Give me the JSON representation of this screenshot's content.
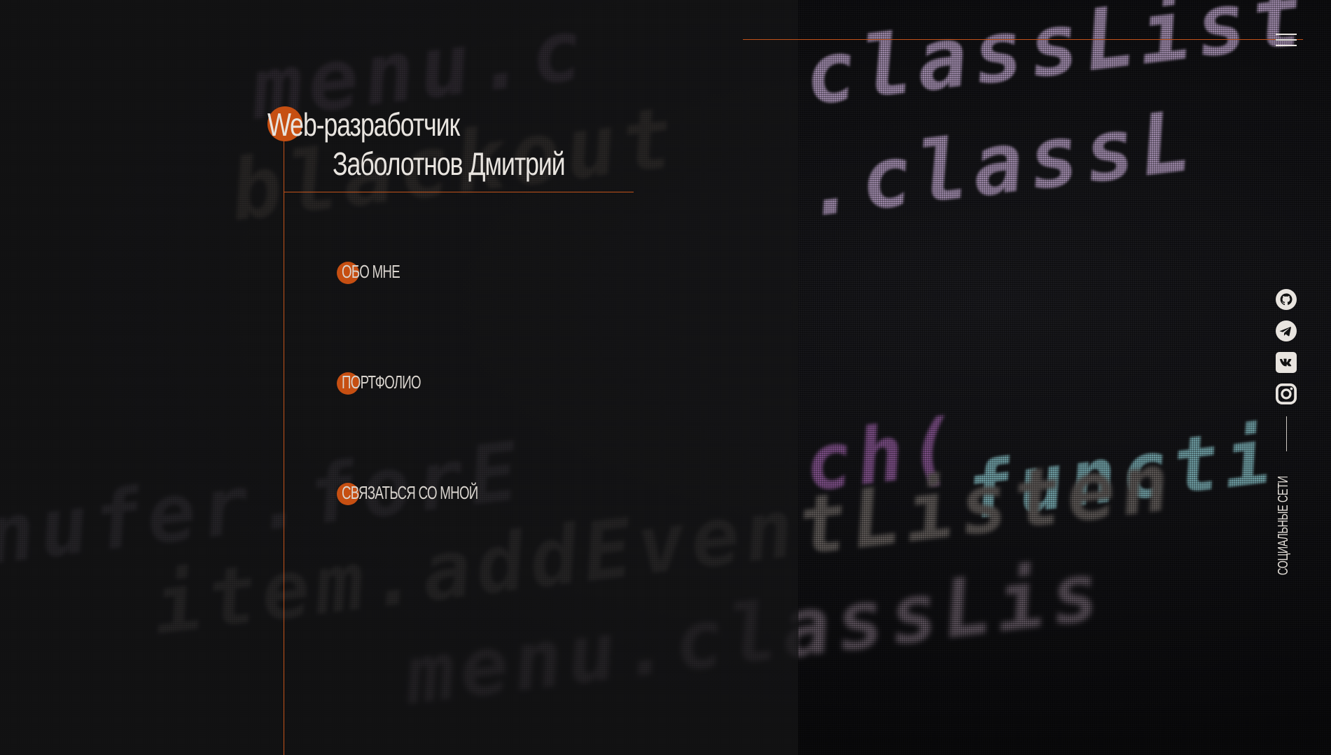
{
  "header": {
    "title_line1": "Web-разработчик",
    "title_line2": "Заболотнов Дмитрий"
  },
  "nav": {
    "items": [
      {
        "label": "Обо мне"
      },
      {
        "label": "Портфолио"
      },
      {
        "label": "Связаться со мной"
      }
    ]
  },
  "social": {
    "label": "Социальные сети",
    "icons": [
      "github-icon",
      "telegram-icon",
      "vk-icon",
      "instagram-icon"
    ]
  },
  "menu": {
    "icon": "hamburger-menu-icon"
  },
  "colors": {
    "accent": "#c64f12",
    "text": "#e8e4df",
    "background": "#0b0b0d"
  }
}
